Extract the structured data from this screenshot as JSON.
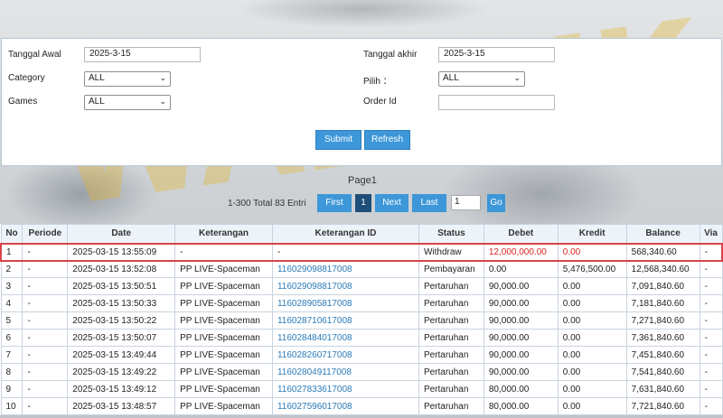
{
  "filters": {
    "tanggal_awal_label": "Tanggal Awal",
    "tanggal_awal_value": "2025-3-15",
    "tanggal_akhir_label": "Tanggal akhir",
    "tanggal_akhir_value": "2025-3-15",
    "category_label": "Category",
    "category_value": "ALL",
    "pilih_label": "Pilih ：",
    "pilih_value": "ALL",
    "games_label": "Games",
    "games_value": "ALL",
    "order_id_label": "Order Id",
    "order_id_value": "",
    "submit_label": "Submit",
    "refresh_label": "Refresh"
  },
  "pager": {
    "title": "Page1",
    "total_text": "1-300 Total 83 Entri",
    "first_label": "First",
    "current_page": "1",
    "next_label": "Next",
    "last_label": "Last",
    "goto_value": "1",
    "go_label": "Go"
  },
  "table": {
    "headers": [
      "No",
      "Periode",
      "Date",
      "Keterangan",
      "Keterangan ID",
      "Status",
      "Debet",
      "Kredit",
      "Balance",
      "Via"
    ],
    "rows": [
      [
        "1",
        "-",
        "2025-03-15 13:55:09",
        "-",
        "-",
        "Withdraw",
        "12,000,000.00",
        "0.00",
        "568,340.60",
        "-"
      ],
      [
        "2",
        "-",
        "2025-03-15 13:52:08",
        "PP LIVE-Spaceman",
        "116029098817008",
        "Pembayaran",
        "0.00",
        "5,476,500.00",
        "12,568,340.60",
        "-"
      ],
      [
        "3",
        "-",
        "2025-03-15 13:50:51",
        "PP LIVE-Spaceman",
        "116029098817008",
        "Pertaruhan",
        "90,000.00",
        "0.00",
        "7,091,840.60",
        "-"
      ],
      [
        "4",
        "-",
        "2025-03-15 13:50:33",
        "PP LIVE-Spaceman",
        "116028905817008",
        "Pertaruhan",
        "90,000.00",
        "0.00",
        "7,181,840.60",
        "-"
      ],
      [
        "5",
        "-",
        "2025-03-15 13:50:22",
        "PP LIVE-Spaceman",
        "116028710617008",
        "Pertaruhan",
        "90,000.00",
        "0.00",
        "7,271,840.60",
        "-"
      ],
      [
        "6",
        "-",
        "2025-03-15 13:50:07",
        "PP LIVE-Spaceman",
        "116028484017008",
        "Pertaruhan",
        "90,000.00",
        "0.00",
        "7,361,840.60",
        "-"
      ],
      [
        "7",
        "-",
        "2025-03-15 13:49:44",
        "PP LIVE-Spaceman",
        "116028260717008",
        "Pertaruhan",
        "90,000.00",
        "0.00",
        "7,451,840.60",
        "-"
      ],
      [
        "8",
        "-",
        "2025-03-15 13:49:22",
        "PP LIVE-Spaceman",
        "116028049117008",
        "Pertaruhan",
        "90,000.00",
        "0.00",
        "7,541,840.60",
        "-"
      ],
      [
        "9",
        "-",
        "2025-03-15 13:49:12",
        "PP LIVE-Spaceman",
        "116027833617008",
        "Pertaruhan",
        "80,000.00",
        "0.00",
        "7,631,840.60",
        "-"
      ],
      [
        "10",
        "-",
        "2025-03-15 13:48:57",
        "PP LIVE-Spaceman",
        "116027596017008",
        "Pertaruhan",
        "80,000.00",
        "0.00",
        "7,721,840.60",
        "-"
      ]
    ]
  },
  "colors": {
    "button": "#3d97d8",
    "current_page": "#1f4e78",
    "highlight_border": "#d9444a",
    "negative": "#dd2222",
    "link": "#2a7ab8"
  }
}
